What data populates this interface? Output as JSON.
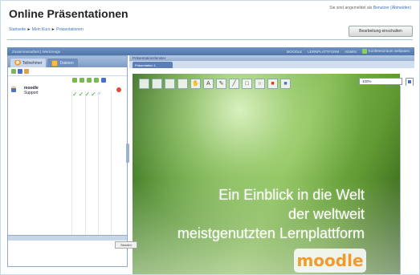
{
  "page": {
    "title": "Online Präsentationen",
    "login_info": "Sie sind angemeldet als",
    "login_user": "Benutzer (Abmelden)",
    "edit_button": "Bearbeitung einschalten"
  },
  "breadcrumb": {
    "items": [
      "Startseite",
      "Mein Kurs",
      "Präsentationen"
    ],
    "separator": "►"
  },
  "topbar": {
    "left_items": [
      "Zusammenarbeit",
      "Werkzeuge"
    ],
    "right_items": [
      "MOODLE",
      "LERNPLATTFORM",
      "ADMIN",
      "Konferenzraum verlassen"
    ]
  },
  "left_panel": {
    "tabs": [
      {
        "label": "Teilnehmer",
        "icon": "people-icon"
      },
      {
        "label": "Dateien",
        "icon": "folder-icon"
      }
    ],
    "users": [
      {
        "name": "moodle",
        "sub": "Support"
      }
    ],
    "check_marks": [
      "✓",
      "✓",
      "✓",
      "✓",
      "✓"
    ],
    "send_button": "Senden"
  },
  "presentation": {
    "header": "Präsentationsfenster",
    "tab_label": "Präsentation 1",
    "zoom": "100%",
    "slide_lines": [
      "Ein Einblick in die Welt",
      "der weltweit",
      "meistgenutzten Lernplattform"
    ],
    "logo_text": "moodle"
  },
  "colors": {
    "topbar": "#5b7eb7",
    "panel_border": "#8fa9c8",
    "check_green": "#3aa13a",
    "logo_orange": "#f29a2d"
  }
}
